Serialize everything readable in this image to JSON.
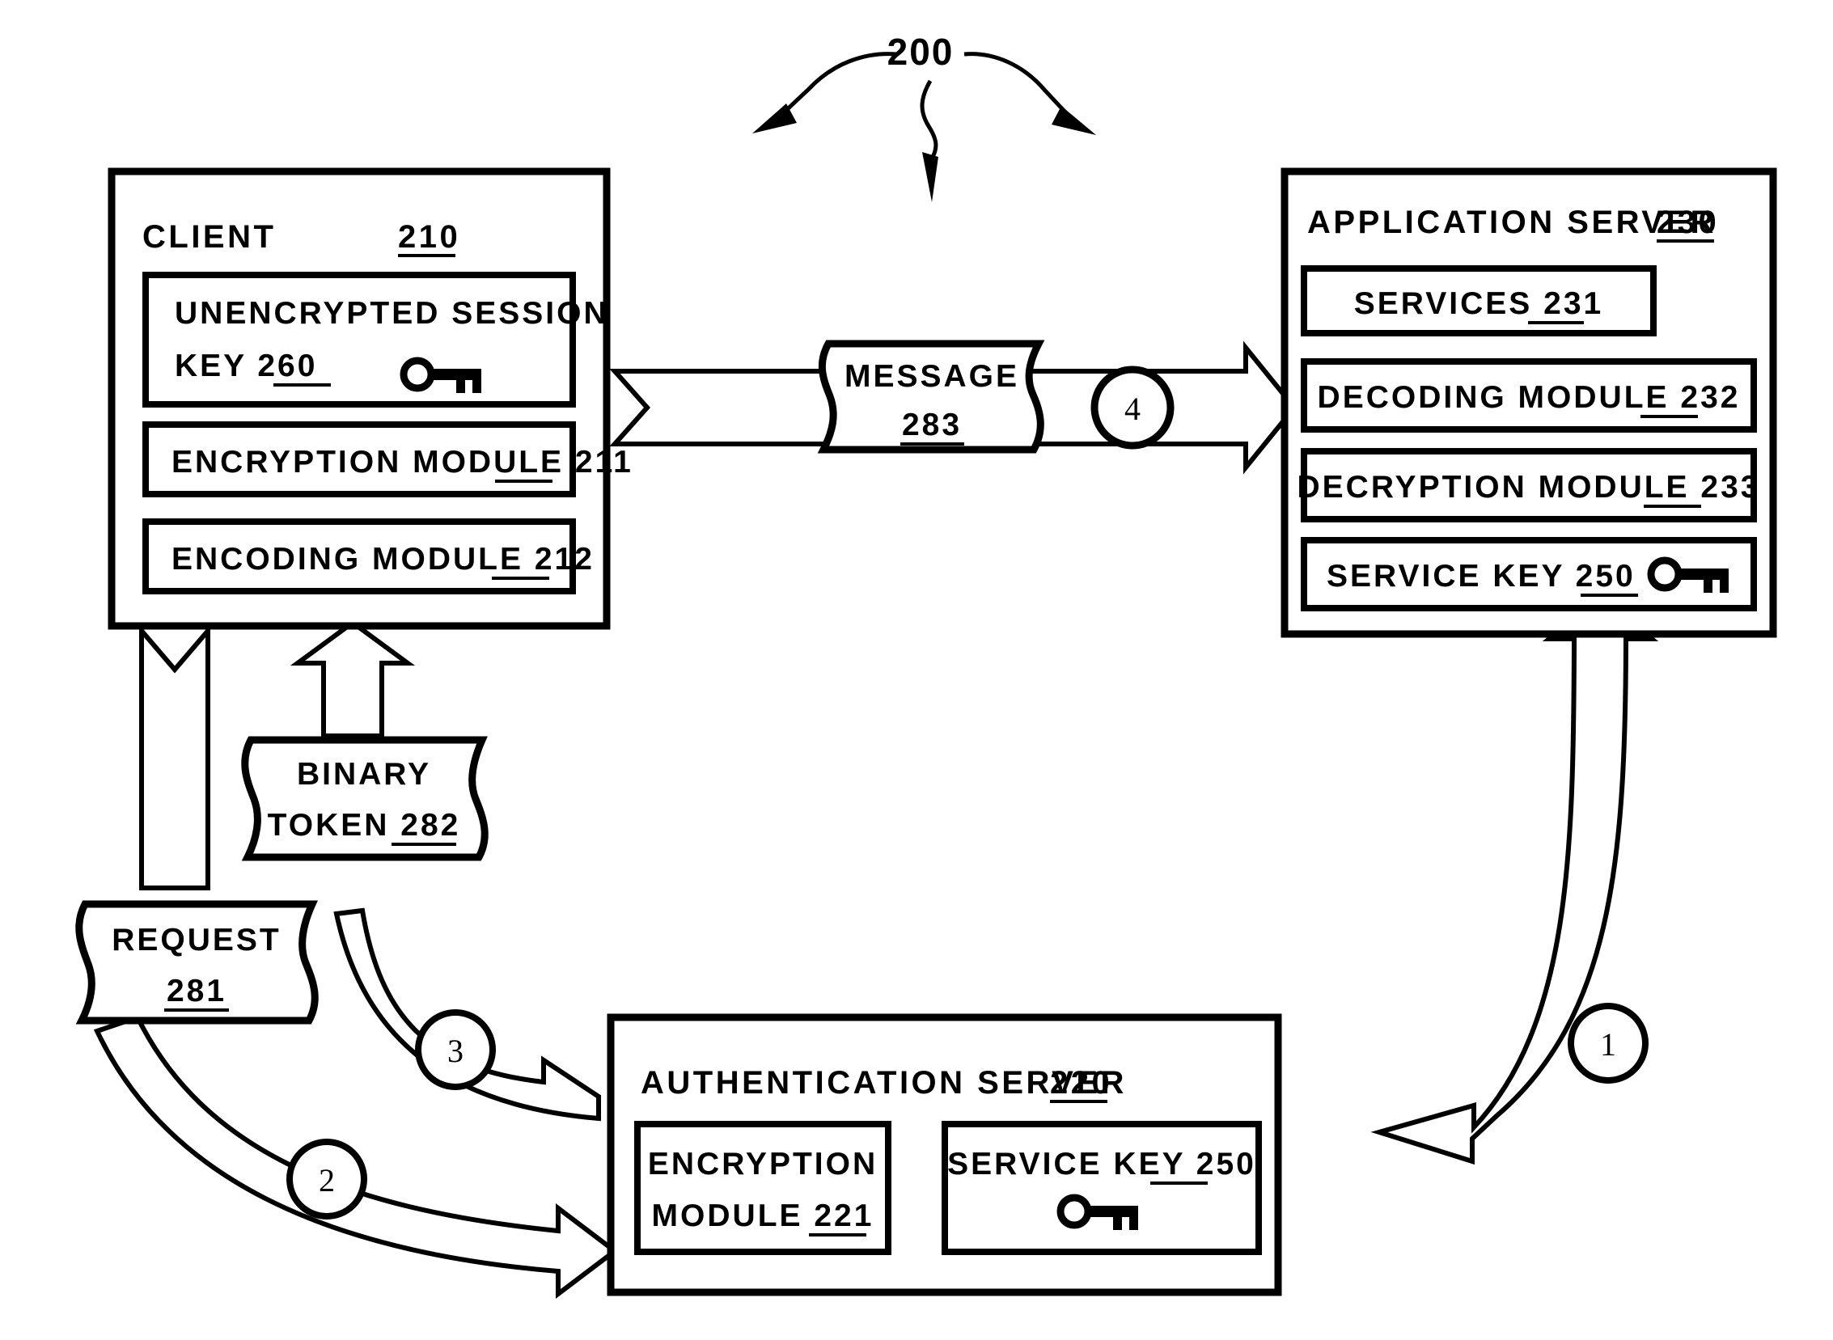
{
  "figure": {
    "reference_label": "200"
  },
  "nodes": {
    "client": {
      "title": "CLIENT 210",
      "title_text": "CLIENT",
      "title_num": "210",
      "items": [
        {
          "line1": "UNENCRYPTED SESSION",
          "line2": "KEY 260",
          "label": "UNENCRYPTED SESSION KEY 260",
          "num": "260",
          "has_key_icon": true
        },
        {
          "line1": "ENCRYPTION MODULE 211",
          "label": "ENCRYPTION MODULE 211",
          "num": "211",
          "has_key_icon": false
        },
        {
          "line1": "ENCODING MODULE 212",
          "label": "ENCODING MODULE 212",
          "num": "212",
          "has_key_icon": false
        }
      ]
    },
    "application_server": {
      "title": "APPLICATION SERVER 230",
      "title_text": "APPLICATION SERVER",
      "title_num": "230",
      "items": [
        {
          "label": "SERVICES 231",
          "num": "231",
          "has_key_icon": false
        },
        {
          "label": "DECODING MODULE 232",
          "num": "232",
          "has_key_icon": false
        },
        {
          "label": "DECRYPTION MODULE 233",
          "num": "233",
          "has_key_icon": false
        },
        {
          "label": "SERVICE KEY 250",
          "num": "250",
          "has_key_icon": true
        }
      ]
    },
    "authentication_server": {
      "title": "AUTHENTICATION SERVER 220",
      "title_text": "AUTHENTICATION SERVER",
      "title_num": "220",
      "items": [
        {
          "line1": "ENCRYPTION",
          "line2": "MODULE 221",
          "label": "ENCRYPTION MODULE 221",
          "num": "221",
          "has_key_icon": false
        },
        {
          "line1": "SERVICE KEY 250",
          "line2": "",
          "label": "SERVICE KEY 250",
          "num": "250",
          "has_key_icon": true
        }
      ]
    }
  },
  "banners": {
    "request": {
      "line1": "REQUEST",
      "line2": "281",
      "num": "281"
    },
    "binary_token": {
      "line1": "BINARY",
      "line2": "TOKEN 282",
      "num": "282"
    },
    "message": {
      "line1": "MESSAGE",
      "line2": "283",
      "num": "283"
    }
  },
  "step_markers": [
    {
      "id": "step-1",
      "label": "1"
    },
    {
      "id": "step-2",
      "label": "2"
    },
    {
      "id": "step-3",
      "label": "3"
    },
    {
      "id": "step-4",
      "label": "4"
    }
  ],
  "colors": {
    "ink": "#000000",
    "paper": "#ffffff"
  }
}
